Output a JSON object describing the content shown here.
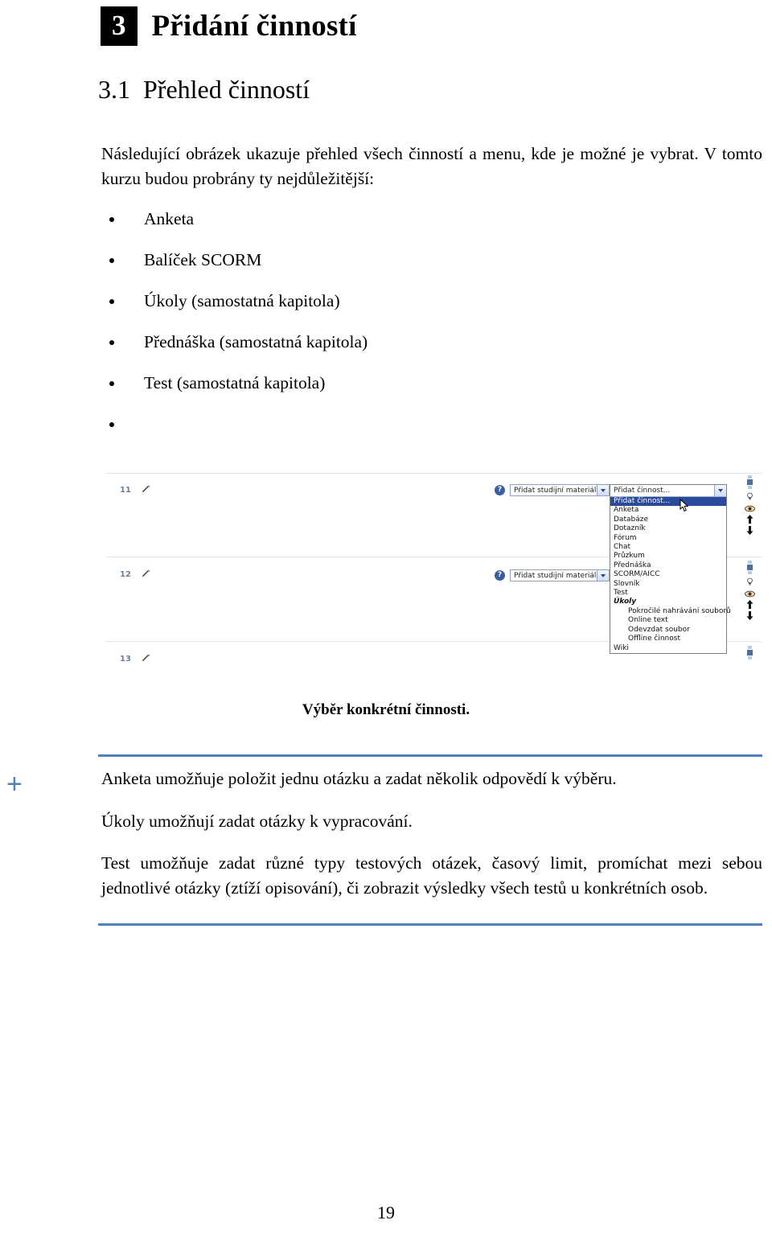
{
  "document": {
    "chapter": {
      "number": "3",
      "title": "Přidání činností"
    },
    "section": {
      "heading": "3.1  Přehled činností"
    },
    "intro_paragraph": "Následující obrázek ukazuje přehled všech činností a menu, kde je možné je vybrat. V tomto kurzu budou probrány ty nejdůležitější:",
    "bullets": [
      {
        "label": "Anketa"
      },
      {
        "label": "Balíček SCORM"
      },
      {
        "label": "Úkoly (samostatná kapitola)"
      },
      {
        "label": "Přednáška (samostatná kapitola)"
      },
      {
        "label": "Test (samostatná kapitola)"
      },
      {
        "label": ""
      }
    ],
    "figure": {
      "caption": "Výběr konkrétní činnosti.",
      "weeks": [
        {
          "number": "11"
        },
        {
          "number": "12"
        },
        {
          "number": "13"
        }
      ],
      "resource_select": {
        "label": "Přidat studijní materiál...",
        "help_icon": "help-question-icon",
        "arrow_icon": "chevron-down-icon"
      },
      "activity_select": {
        "label": "Přidat činnost...",
        "help_icon": "help-question-icon",
        "arrow_icon": "chevron-down-icon"
      },
      "activity_options": [
        {
          "label": "Přidat činnost...",
          "selected": true,
          "group": false,
          "indent": false
        },
        {
          "label": "Anketa",
          "selected": false,
          "group": false,
          "indent": false
        },
        {
          "label": "Databáze",
          "selected": false,
          "group": false,
          "indent": false
        },
        {
          "label": "Dotazník",
          "selected": false,
          "group": false,
          "indent": false
        },
        {
          "label": "Fórum",
          "selected": false,
          "group": false,
          "indent": false
        },
        {
          "label": "Chat",
          "selected": false,
          "group": false,
          "indent": false
        },
        {
          "label": "Průzkum",
          "selected": false,
          "group": false,
          "indent": false
        },
        {
          "label": "Přednáška",
          "selected": false,
          "group": false,
          "indent": false
        },
        {
          "label": "SCORM/AICC",
          "selected": false,
          "group": false,
          "indent": false
        },
        {
          "label": "Slovník",
          "selected": false,
          "group": false,
          "indent": false
        },
        {
          "label": "Test",
          "selected": false,
          "group": false,
          "indent": false
        },
        {
          "label": "Úkoly",
          "selected": false,
          "group": true,
          "indent": false
        },
        {
          "label": "Pokročilé nahrávání souborů",
          "selected": false,
          "group": false,
          "indent": true
        },
        {
          "label": "Online text",
          "selected": false,
          "group": false,
          "indent": true
        },
        {
          "label": "Odevzdat soubor",
          "selected": false,
          "group": false,
          "indent": true
        },
        {
          "label": "Offline činnost",
          "selected": false,
          "group": false,
          "indent": true
        },
        {
          "label": "Wiki",
          "selected": false,
          "group": false,
          "indent": false
        }
      ],
      "rail_icons": [
        "lightbulb-icon",
        "eye-icon",
        "arrow-up-icon",
        "arrow-down-icon"
      ],
      "edit_icon": "edit-pencil-icon",
      "cursor_icon": "mouse-pointer-icon"
    },
    "tip": {
      "marker": "+",
      "paragraphs": [
        "Anketa umožňuje položit jednu otázku a zadat několik odpovědí k výběru.",
        "Úkoly umožňují zadat otázky k vypracování.",
        "Test umožňuje zadat různé typy testových otázek, časový limit, promíchat mezi sebou jednotlivé otázky (ztíží opisování), či zobrazit výsledky všech testů u konkrétních osob."
      ]
    },
    "page_number": "19",
    "colors": {
      "accent_blue": "#4f81bd",
      "moodle_select_border": "#8ba3c7",
      "dropdown_selected": "#2a4b9b",
      "week_number": "#6a7f99"
    }
  }
}
